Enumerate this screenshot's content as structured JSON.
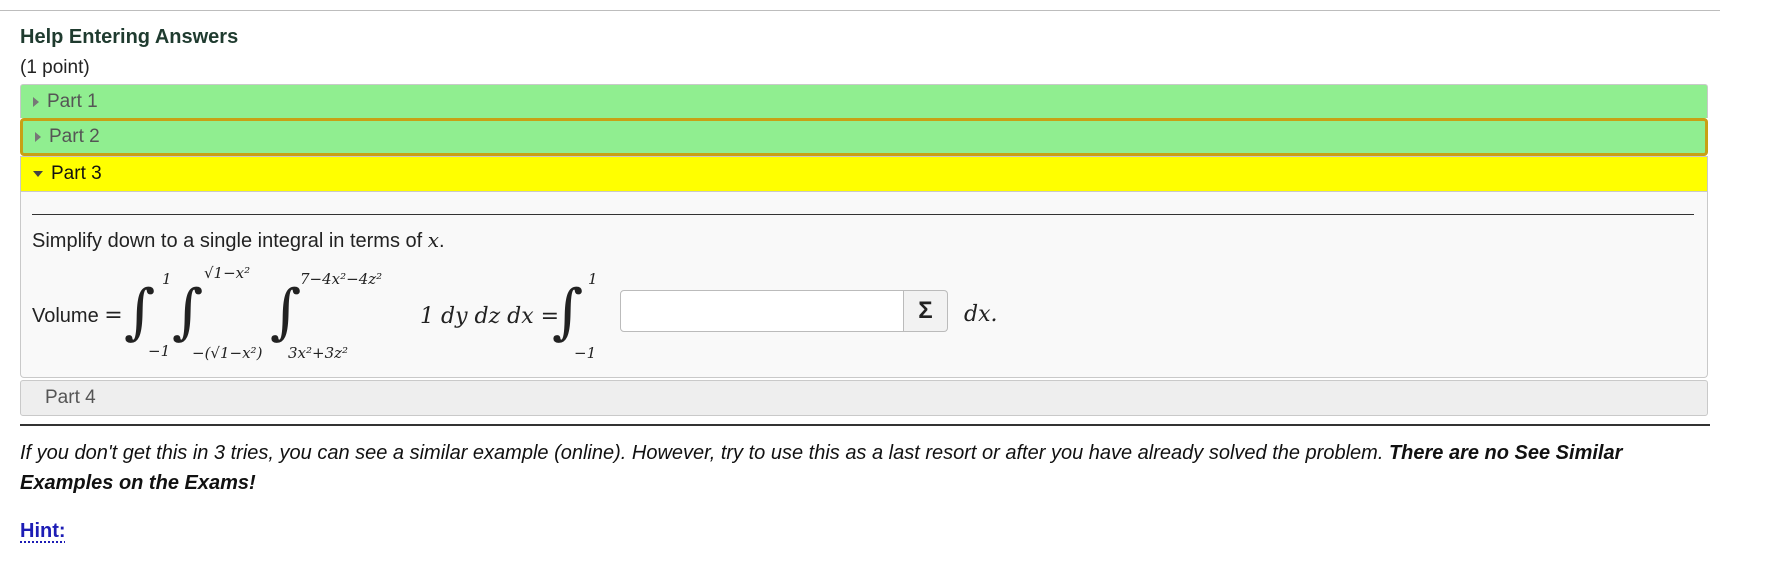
{
  "header": {
    "title": "Help Entering Answers",
    "points": "(1 point)"
  },
  "parts": [
    {
      "label": "Part 1",
      "state": "collapsed",
      "color": "#90ee90"
    },
    {
      "label": "Part 2",
      "state": "collapsed-focused",
      "color": "#90ee90"
    },
    {
      "label": "Part 3",
      "state": "expanded",
      "color": "#ffff00"
    },
    {
      "label": "Part 4",
      "state": "collapsed",
      "color": "#eeeeee"
    }
  ],
  "part3": {
    "instruction_text": "Simplify down to a single integral in terms of ",
    "instruction_var": "x",
    "instruction_end": ".",
    "volume_label": "Volume",
    "equals": "=",
    "integral1": {
      "upper": "1",
      "lower": "−1"
    },
    "integral2": {
      "upper": "√1−x²",
      "lower": "−(√1−x²)"
    },
    "integral3": {
      "upper": "7−4x²−4z²",
      "lower": "3x²+3z²"
    },
    "integrand": "1 dy dz dx",
    "integral_rhs": {
      "upper": "1",
      "lower": "−1"
    },
    "answer_value": "",
    "answer_placeholder": "",
    "sigma_label": "Σ",
    "dx_label": "dx."
  },
  "note": {
    "italic_text": "If you don't get this in 3 tries, you can see a similar example (online). However, try to use this as a last resort or after you have already solved the problem. ",
    "bold_text": "There are no See Similar Examples on the Exams!"
  },
  "hint": {
    "label": "Hint:"
  },
  "colors": {
    "part_correct": "#90ee90",
    "part_active": "#ffff00",
    "focus_border": "#c8a014",
    "hint_link": "#1d1db5"
  }
}
